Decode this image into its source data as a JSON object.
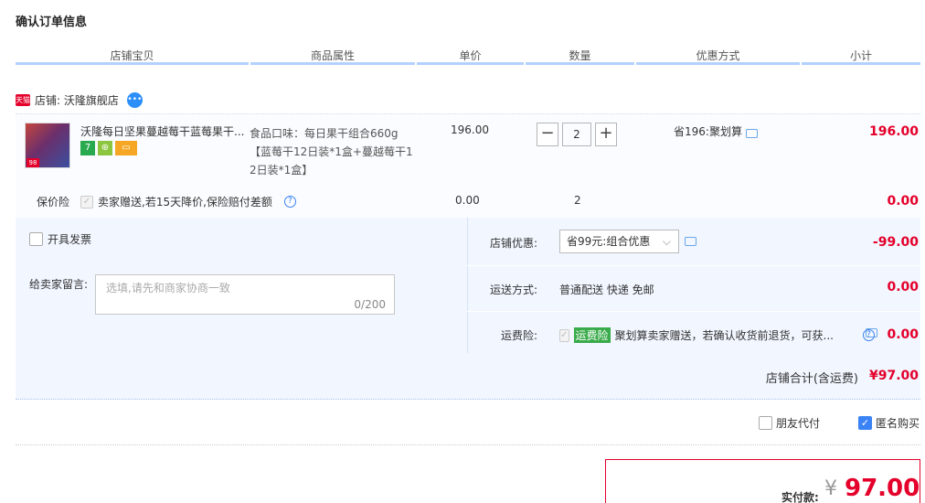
{
  "page_title": "确认订单信息",
  "columns": [
    "店铺宝贝",
    "商品属性",
    "单价",
    "数量",
    "优惠方式",
    "小计"
  ],
  "shop": {
    "badge": "天猫",
    "label": "店铺: 沃隆旗舰店"
  },
  "item": {
    "title": "沃隆每日坚果蔓越莓干蓝莓果干...",
    "thumb_tag": "98",
    "attr_line1": "食品口味：每日果干组合660g",
    "attr_line2": "【蓝莓干12日装*1盒+蔓越莓干1",
    "attr_line3": "2日装*1盒】",
    "price": "196.00",
    "quantity": "2",
    "minus": "−",
    "plus": "+",
    "promo": "省196:聚划算",
    "subtotal": "196.00"
  },
  "insurance": {
    "label": "保价险",
    "desc": "卖家赠送,若15天降价,保险赔付差额",
    "price": "0.00",
    "qty": "2",
    "subtotal": "0.00"
  },
  "invoice": {
    "label": "开具发票"
  },
  "remark": {
    "label": "给卖家留言:",
    "placeholder": "选填,请先和商家协商一致",
    "counter": "0/200"
  },
  "shop_discount": {
    "label": "店铺优惠:",
    "selected": "省99元:组合优惠",
    "amount": "-99.00"
  },
  "shipping": {
    "label": "运送方式:",
    "value": "普通配送 快递 免邮",
    "amount": "0.00"
  },
  "shipping_insurance": {
    "label": "运费险:",
    "tag": "运费险",
    "desc": "聚划算卖家赠送，若确认收货前退货，可获...",
    "amount": "0.00"
  },
  "shop_total": {
    "label": "店铺合计(含运费)",
    "amount": "¥97.00"
  },
  "options": {
    "friend_pay": "朋友代付",
    "anonymous": "匿名购买"
  },
  "payment": {
    "label": "实付款:",
    "currency": "¥",
    "amount": "97.00"
  },
  "colors": {
    "accent_red": "#e4002b",
    "header_line": "#b2d1ff",
    "panel_bg": "#f1f6ff",
    "check_blue": "#3a83f6"
  }
}
